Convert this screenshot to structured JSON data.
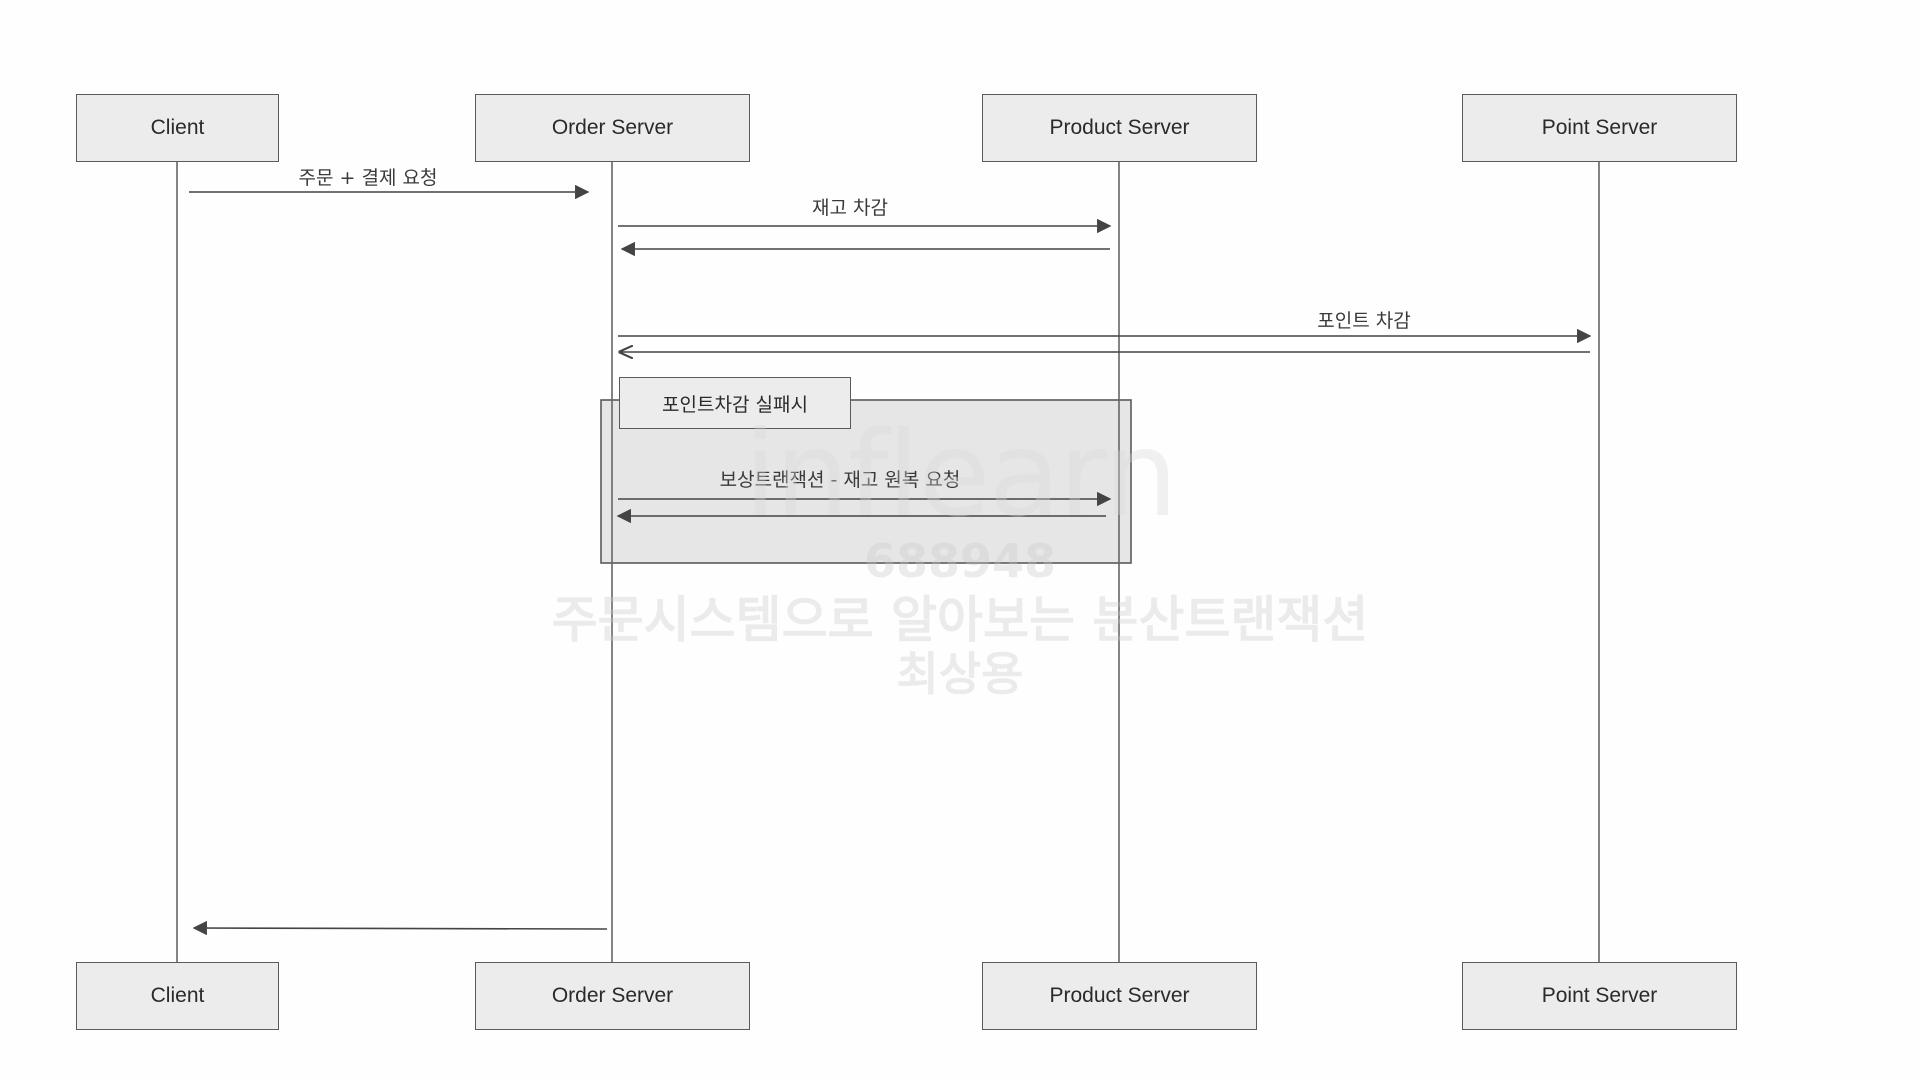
{
  "participants": {
    "client": "Client",
    "order": "Order Server",
    "product": "Product Server",
    "point": "Point Server"
  },
  "messages": {
    "order_payment_request": "주문 + 결제 요청",
    "stock_deduct": "재고 차감",
    "point_deduct": "포인트 차감",
    "compensation": "보상트랜잭션 - 재고 원복 요청"
  },
  "frame": {
    "condition": "포인트차감 실패시"
  },
  "watermark": {
    "logo": "inflearn",
    "id": "688948",
    "course": "주문시스템으로 알아보는 분산트랜잭션",
    "name": "최상용"
  }
}
